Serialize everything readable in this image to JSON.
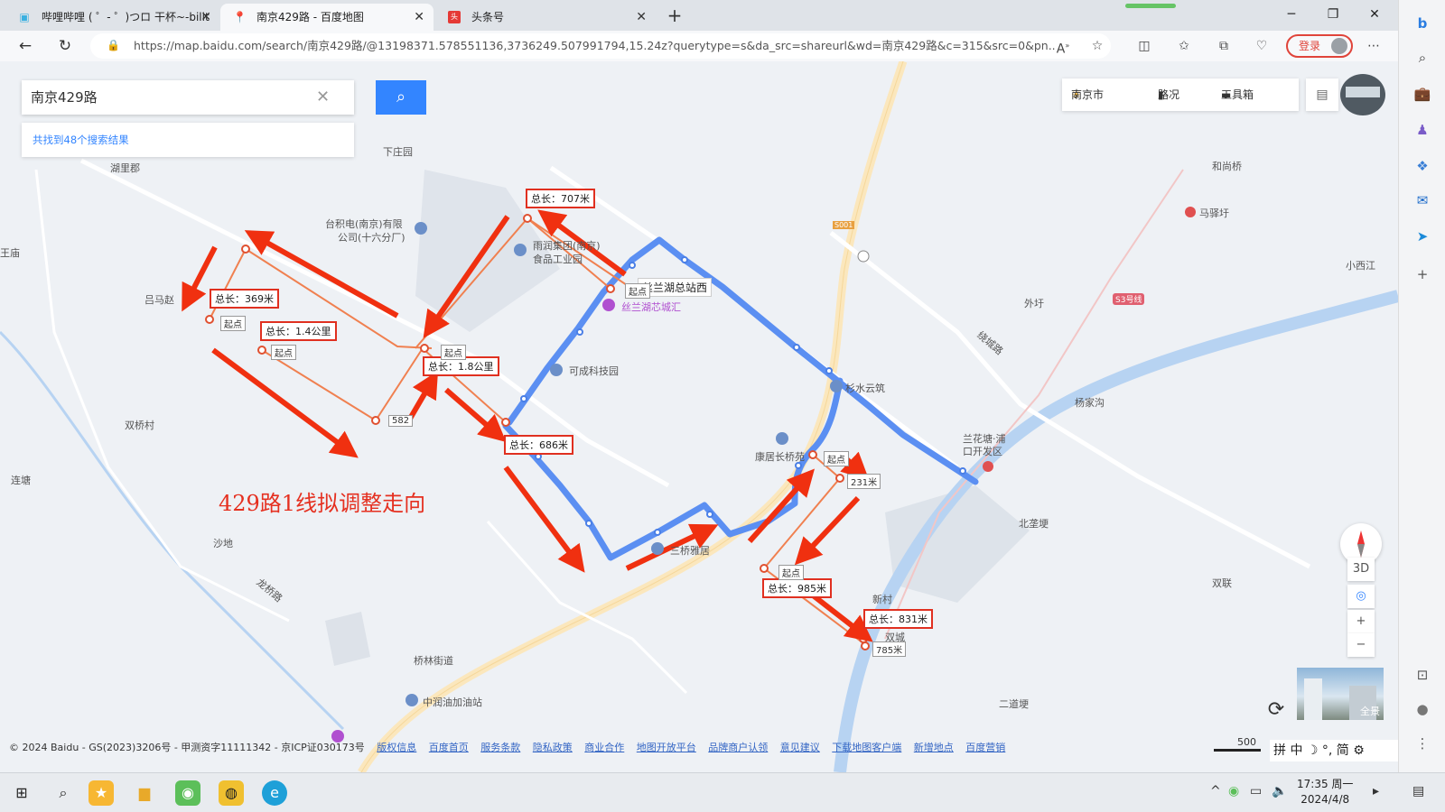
{
  "browser": {
    "tabs": [
      {
        "title": "哔哩哔哩 ( ゜- ゜)つロ 干杯~-bilit",
        "active": false
      },
      {
        "title": "南京429路 - 百度地图",
        "active": true
      },
      {
        "title": "头条号",
        "active": false
      }
    ],
    "url": "https://map.baidu.com/search/南京429路/@13198371.578551136,3736249.507991794,15.24z?querytype=s&da_src=shareurl&wd=南京429路&c=315&src=0&pn...",
    "login_label": "登录"
  },
  "map": {
    "search_query": "南京429路",
    "result_text": "共找到48个搜索结果",
    "city": "南京市",
    "traffic": "路况",
    "toolbox": "工具箱",
    "overlay_title": "429路1线拟调整走向",
    "stop_callout": "丝兰湖总站西",
    "badges": [
      "总长：707米",
      "总长：369米",
      "总长：1.4公里",
      "总长：1.8公里",
      "总长：686米",
      "总长：985米",
      "总长：831米"
    ],
    "start_label": "起点",
    "dist_labels": [
      "582",
      "231米",
      "785米"
    ],
    "place_labels": [
      "下庄园",
      "湖里郡",
      "台积电(南京)有限",
      "公司(十六分厂)",
      "雨润集团(南京)",
      "食品工业园",
      "吕马赵",
      "丝兰湖芯城汇",
      "可成科技园",
      "双桥村",
      "康居长桥苑",
      "杉水云筑",
      "三桥雅居",
      "沙地",
      "龙桥路",
      "连塘",
      "桥林街道",
      "中润油加油站",
      "和尚桥",
      "马驿圩",
      "小西江",
      "外圩",
      "绕城路",
      "杨家沟",
      "兰花塘·浦口开发区",
      "北垄埂",
      "双联",
      "新村",
      "二道埂",
      "双城",
      "王庙",
      "S3号线",
      "S001"
    ],
    "footer_copyright": "© 2024 Baidu - GS(2023)3206号 - 甲测资字11111342 - 京ICP证030173号",
    "footer_links": [
      "版权信息",
      "百度首页",
      "服务条款",
      "隐私政策",
      "商业合作",
      "地图开放平台",
      "品牌商户认领",
      "意见建议",
      "下载地图客户端",
      "新增地点",
      "百度营销"
    ],
    "scale": "500",
    "pano_label": "全景",
    "ime": "拼 中 ☽ °, 简 ⚙"
  },
  "taskbar": {
    "time": "17:35 周一",
    "date": "2024/4/8"
  },
  "colors": {
    "route_blue": "#5b8ff2",
    "proposal_orange": "#f08050",
    "arrow_red": "#f03010",
    "accent_blue": "#3385ff"
  }
}
